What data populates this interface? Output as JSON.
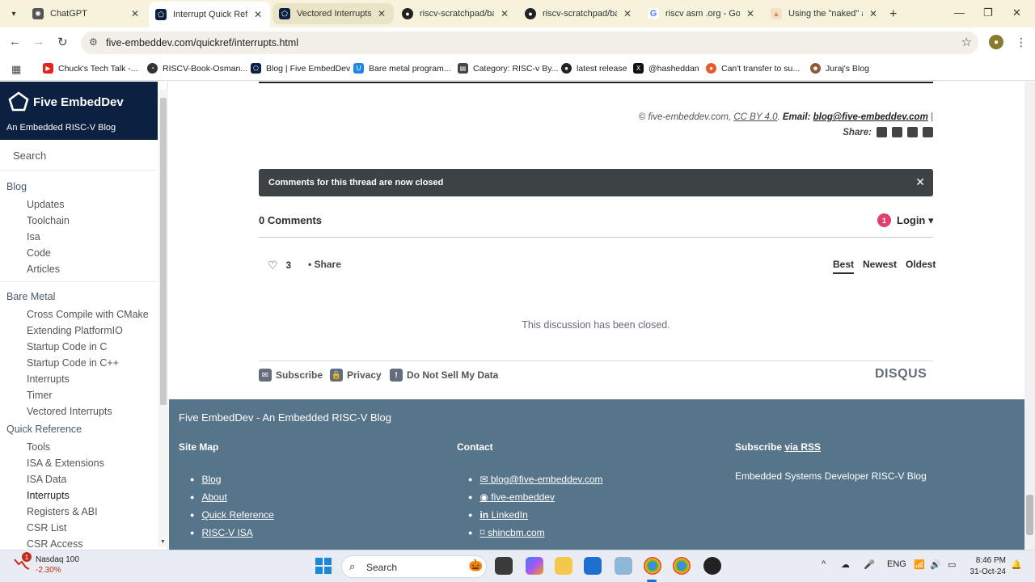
{
  "browser": {
    "tabs": [
      {
        "title": "ChatGPT",
        "fav_color": "#555555",
        "fav_glyph": "✺"
      },
      {
        "title": "Interrupt Quick Refer",
        "fav_color": "#0c2141",
        "fav_glyph": "⬠"
      },
      {
        "title": "Vectored Interrupts |",
        "fav_color": "#0c2141",
        "fav_glyph": "⬠"
      },
      {
        "title": "riscv-scratchpad/bar",
        "fav_color": "#222222",
        "fav_glyph": "●"
      },
      {
        "title": "riscv-scratchpad/bar",
        "fav_color": "#222222",
        "fav_glyph": "●"
      },
      {
        "title": "riscv asm .org - Goog",
        "fav_color": "#4285f4",
        "fav_glyph": "G"
      },
      {
        "title": "Using the \"naked\" at",
        "fav_color": "#e8833a",
        "fav_glyph": "▲"
      }
    ],
    "url": "five-embeddev.com/quickref/interrupts.html",
    "bookmarks": [
      {
        "label": "Chuck's Tech Talk -...",
        "color": "#e62117",
        "glyph": "▶"
      },
      {
        "label": "RISCV-Book-Osman...",
        "color": "#333333",
        "glyph": "◔"
      },
      {
        "label": "Blog | Five EmbedDev",
        "color": "#0c2141",
        "glyph": "⬠"
      },
      {
        "label": "Bare metal program...",
        "color": "#1e88e5",
        "glyph": "U"
      },
      {
        "label": "Category: RISC-v By...",
        "color": "#444444",
        "glyph": "▤"
      },
      {
        "label": "latest release",
        "color": "#222222",
        "glyph": "●"
      },
      {
        "label": "@hasheddan",
        "color": "#111111",
        "glyph": "X"
      },
      {
        "label": "Can't transfer to su...",
        "color": "#e65c2d",
        "glyph": "●"
      },
      {
        "label": "Juraj's Blog",
        "color": "#8a5a3a",
        "glyph": "☻"
      }
    ]
  },
  "sidebar": {
    "brand_name": "Five EmbedDev",
    "tagline": "An Embedded RISC-V Blog",
    "search_placeholder": "Search",
    "sections": [
      {
        "title": "Blog",
        "items": [
          "Updates",
          "Toolchain",
          "Isa",
          "Code",
          "Articles"
        ]
      },
      {
        "title": "Bare Metal",
        "items": [
          "Cross Compile with CMake",
          "Extending PlatformIO",
          "Startup Code in C",
          "Startup Code in C++",
          "Interrupts",
          "Timer",
          "Vectored Interrupts"
        ]
      },
      {
        "title": "Quick Reference",
        "items": [
          "Tools",
          "ISA & Extensions",
          "ISA Data",
          "Interrupts",
          "Registers & ABI",
          "CSR List",
          "CSR Access"
        ]
      }
    ]
  },
  "page": {
    "credits_prefix": "© five-embeddev.com,",
    "license": "CC BY 4.0",
    "email_label": "Email:",
    "email": "blog@five-embeddev.com",
    "share_label": "Share:"
  },
  "disqus": {
    "closed_banner": "Comments for this thread are now closed",
    "comment_count": "0 Comments",
    "badge": "1",
    "login": "Login ▾",
    "likes": "3",
    "share": "Share",
    "sort": [
      "Best",
      "Newest",
      "Oldest"
    ],
    "closed_note": "This discussion has been closed.",
    "footer_links": [
      "Subscribe",
      "Privacy",
      "Do Not Sell My Data"
    ],
    "brand": "DISQUS"
  },
  "footer": {
    "title": "Five EmbedDev - An Embedded RISC-V Blog",
    "sitemap_heading": "Site Map",
    "sitemap_links": [
      "Blog",
      "About",
      "Quick Reference",
      "RISC-V ISA"
    ],
    "contact_heading": "Contact",
    "contact_links": [
      {
        "icon": "✉",
        "label": " blog@five-embeddev.com"
      },
      {
        "icon": "◉",
        "label": " five-embeddev"
      },
      {
        "icon": "in",
        "label": " LinkedIn"
      },
      {
        "icon": "⌑",
        "label": " shincbm.com"
      }
    ],
    "subscribe_heading": "Subscribe",
    "subscribe_link": "via RSS",
    "subscribe_text": "Embedded Systems Developer RISC-V Blog"
  },
  "taskbar": {
    "stock_name": "Nasdaq 100",
    "stock_change": "-2.30%",
    "stock_badge": "1",
    "search_label": "Search",
    "lang": "ENG",
    "time": "8:46 PM",
    "date": "31-Oct-24"
  }
}
